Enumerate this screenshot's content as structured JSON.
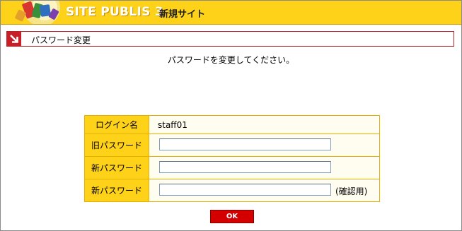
{
  "header": {
    "brand": "SITE PUBLIS 3",
    "site_name": "新規サイト"
  },
  "section": {
    "title": "パスワード変更"
  },
  "instruction": "パスワードを変更してください。",
  "form": {
    "login_label": "ログイン名",
    "login_value": "staff01",
    "old_password_label": "旧パスワード",
    "old_password_value": "",
    "new_password_label": "新パスワード",
    "new_password_value": "",
    "confirm_password_label": "新パスワード",
    "confirm_password_value": "",
    "confirm_note": "(確認用)"
  },
  "ok_label": "OK",
  "colors": {
    "header_bg": "#ffd21a",
    "section_border": "#b8202a",
    "ok_button": "#d40000"
  }
}
